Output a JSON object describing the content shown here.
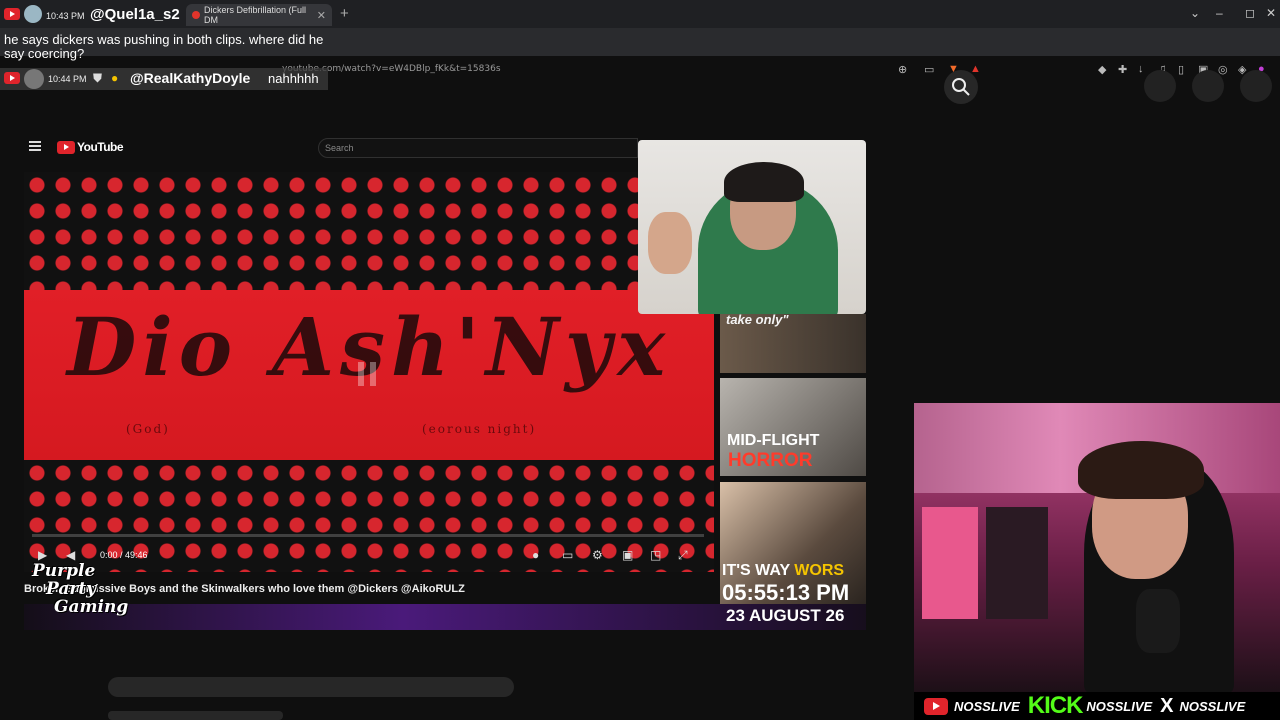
{
  "browser": {
    "tab_title": "Dickers Defibrillation (Full DM",
    "new_tab": "+",
    "url": "youtube.com/watch?v=eW4DBlp_fKk&t=15836s",
    "window_controls": [
      "⌄",
      "–",
      "◻",
      "✕"
    ]
  },
  "chat": {
    "messages": [
      {
        "time": "10:43 PM",
        "user": "@Quel1a_s2",
        "text": "he says dickers was pushing in both clips. where did he say coercing?"
      },
      {
        "time": "10:44 PM",
        "user": "@RealKathyDoyle",
        "text": "nahhhhh"
      }
    ]
  },
  "youtube_inner": {
    "logo_text": "YouTube",
    "search_placeholder": "Search",
    "video": {
      "title_art": "Dio Ash'Nyx",
      "sub_left": "(God)",
      "sub_right": "(eorous night)",
      "time": "0:00 / 49:46"
    },
    "caption": "Broken Submissive Boys and the Skinwalkers who love them @Dickers @AikoRULZ",
    "caption_prefix": "Brok",
    "purple_party": [
      "Purple",
      "Party",
      "Gaming"
    ]
  },
  "sidebar": {
    "thumb1_text": "take only\"",
    "thumb2_line1": "MID-FLIGHT",
    "thumb2_line2": "HORROR",
    "thumb3_text_a": "IT'S WAY ",
    "thumb3_text_b": "WORS"
  },
  "overlay": {
    "clock": "05:55:13 PM",
    "date": "23 AUGUST 26"
  },
  "social": {
    "youtube_name": "NOSSLIVE",
    "kick_label": "KICK",
    "kick_name": "NOSSLIVE",
    "x_label": "X",
    "x_name": "NOSSLIVE"
  },
  "colors": {
    "youtube_red": "#e0242b",
    "kick_green": "#53fc18",
    "video_red": "#d7262e"
  }
}
